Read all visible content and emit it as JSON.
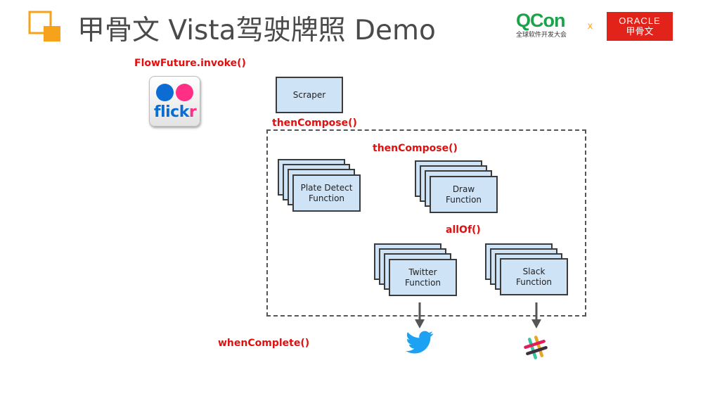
{
  "header": {
    "title": "甲骨文 Vista驾驶牌照 Demo",
    "logos": {
      "qcon": {
        "name": "QCon",
        "tagline": "全球软件开发大会"
      },
      "separator": "x",
      "oracle": {
        "line1": "ORACLE",
        "line2": "甲骨文"
      }
    }
  },
  "diagram": {
    "source_call": "FlowFuture.invoke()",
    "flickr_word": {
      "main": "flick",
      "accent": "r"
    },
    "scraper_label": "Scraper",
    "then_compose_outer": "thenCompose()",
    "then_compose_inner": "thenCompose()",
    "all_of": "allOf()",
    "when_complete": "whenComplete()",
    "functions": {
      "plate_detect": "Plate Detect\nFunction",
      "draw": "Draw\nFunction",
      "twitter": "Twitter\nFunction",
      "slack": "Slack\nFunction"
    }
  },
  "colors": {
    "code_red": "#e01010",
    "box_fill": "#cfe3f6",
    "twitter_blue": "#1da1f2",
    "oracle_red": "#e2231a",
    "qcon_green": "#1aa34a",
    "qcon_blue": "#1d5fa8",
    "accent_orange": "#f7a21b"
  },
  "icons": [
    "square-logo-icon",
    "flickr-icon",
    "twitter-icon",
    "slack-icon",
    "arrow-down-icon"
  ]
}
